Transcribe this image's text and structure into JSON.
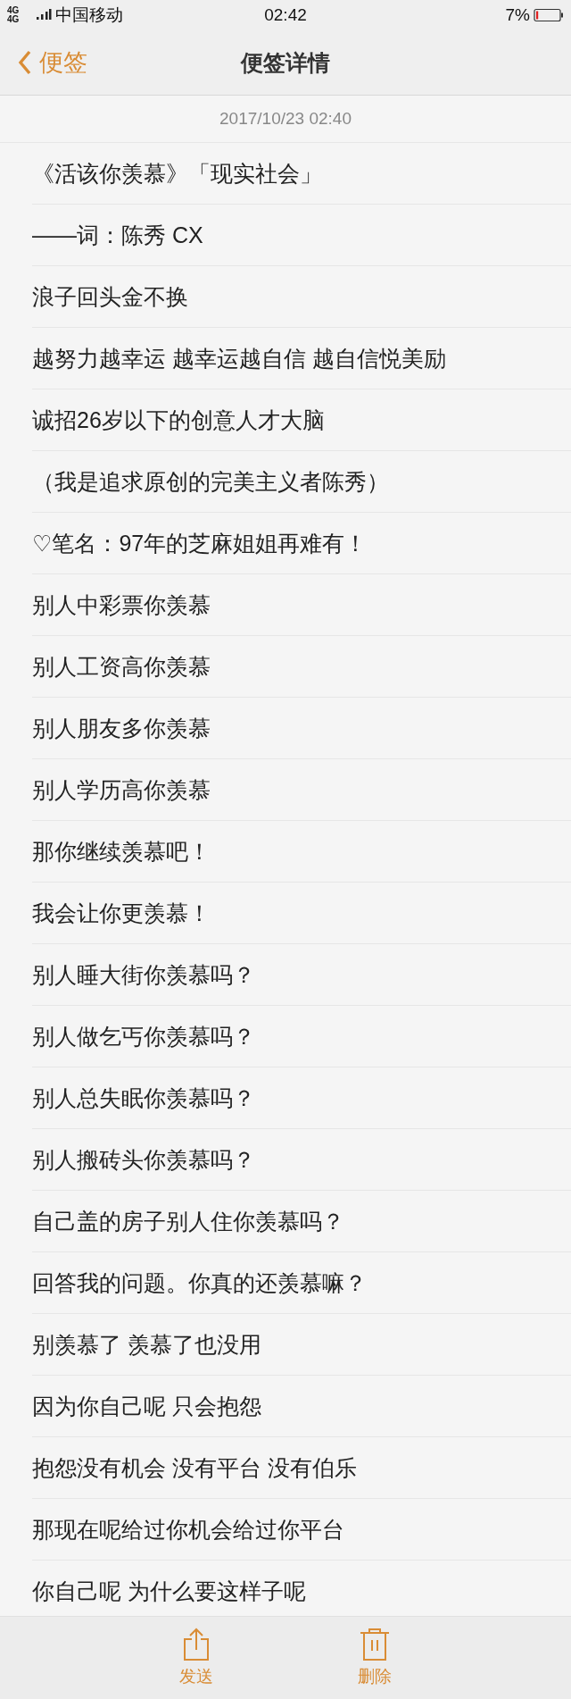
{
  "status_bar": {
    "network": "4G 4G",
    "carrier": "中国移动",
    "time": "02:42",
    "battery": "7%"
  },
  "nav": {
    "back": "便签",
    "title": "便签详情"
  },
  "note": {
    "date": "2017/10/23 02:40",
    "lines": [
      "《活该你羡慕》「现实社会」",
      "——词：陈秀 CX",
      "浪子回头金不换",
      "越努力越幸运 越幸运越自信 越自信悦美励",
      "诚招26岁以下的创意人才大脑",
      "（我是追求原创的完美主义者陈秀）",
      "♡笔名：97年的芝麻姐姐再难有！",
      "别人中彩票你羡慕",
      "别人工资高你羡慕",
      "别人朋友多你羡慕",
      "别人学历高你羡慕",
      "那你继续羡慕吧！",
      "我会让你更羡慕！",
      "别人睡大街你羡慕吗？",
      "别人做乞丐你羡慕吗？",
      "别人总失眠你羡慕吗？",
      "别人搬砖头你羡慕吗？",
      "自己盖的房子别人住你羡慕吗？",
      "回答我的问题。你真的还羡慕嘛？",
      "别羡慕了 羡慕了也没用",
      "因为你自己呢 只会抱怨",
      "抱怨没有机会 没有平台 没有伯乐",
      "那现在呢给过你机会给过你平台",
      "你自己呢 为什么要这样子呢"
    ]
  },
  "toolbar": [
    {
      "kind": "share",
      "label": "发送"
    },
    {
      "kind": "delete",
      "label": "删除"
    }
  ]
}
